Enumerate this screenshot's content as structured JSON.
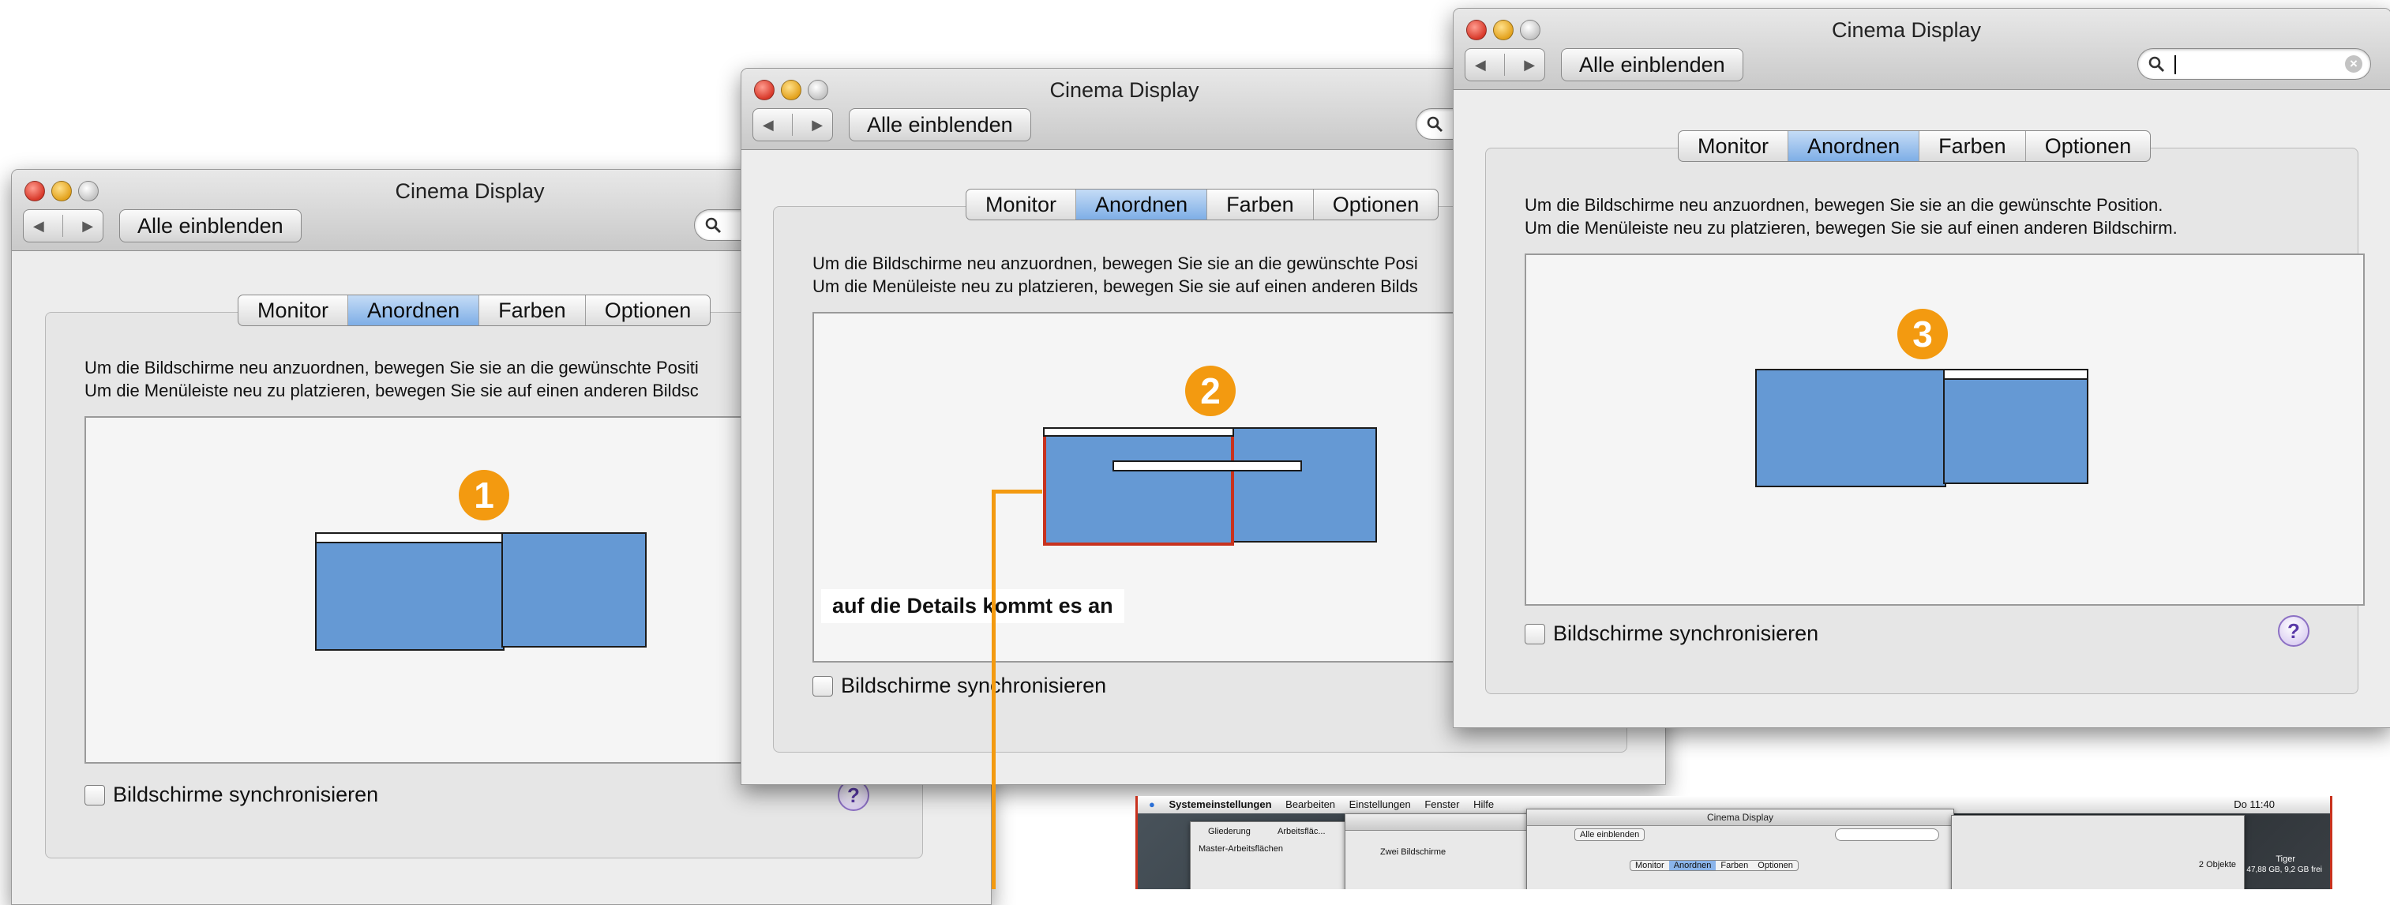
{
  "window": {
    "title": "Cinema Display",
    "show_all": "Alle einblenden",
    "nav_back": "◀",
    "nav_forward": "▶"
  },
  "tabs": [
    "Monitor",
    "Anordnen",
    "Farben",
    "Optionen"
  ],
  "active_tab": "Anordnen",
  "description": {
    "line1": "Um die Bildschirme neu anzuordnen, bewegen Sie sie an die gewünschte Position.",
    "line2": "Um die Menüleiste neu zu platzieren, bewegen Sie sie auf einen anderen Bildschirm."
  },
  "description_clipped": {
    "w1_line1": "Um die Bildschirme neu anzuordnen, bewegen Sie sie an die gewünschte Positi",
    "w1_line2": "Um die Menüleiste neu zu platzieren, bewegen Sie sie auf einen anderen Bildsc",
    "w2_line1": "Um die Bildschirme neu anzuordnen, bewegen Sie sie an die gewünschte Posi",
    "w2_line2": "Um die Menüleiste neu zu platzieren, bewegen Sie sie auf einen anderen Bilds"
  },
  "mirror_checkbox": {
    "label": "Bildschirme synchronisieren",
    "checked": false
  },
  "help": "?",
  "badges": [
    "1",
    "2",
    "3"
  ],
  "callout": "auf die Details kommt es an",
  "thumbnail": {
    "menubar": [
      "Systemeinstellungen",
      "Bearbeiten",
      "Einstellungen",
      "Fenster",
      "Hilfe"
    ],
    "clock": "Do 11:40",
    "window_title": "Cinema Display",
    "show_all": "Alle einblenden",
    "tabs": [
      "Monitor",
      "Anordnen",
      "Farben",
      "Optionen"
    ],
    "sidebar_tabs": [
      "Gliederung",
      "Arbeitsfläc..."
    ],
    "sidebar_header": "Master-Arbeitsflächen",
    "doc_label": "Zwei Bildschirme",
    "status": "2 Objekte",
    "disk_name": "Tiger",
    "disk_info": "47,88 GB, 9,2 GB frei"
  },
  "colors": {
    "accent_orange": "#f39a10",
    "monitor_blue": "#6599d4",
    "tab_active": "#7eaee6",
    "highlight_red": "#c8321e"
  }
}
